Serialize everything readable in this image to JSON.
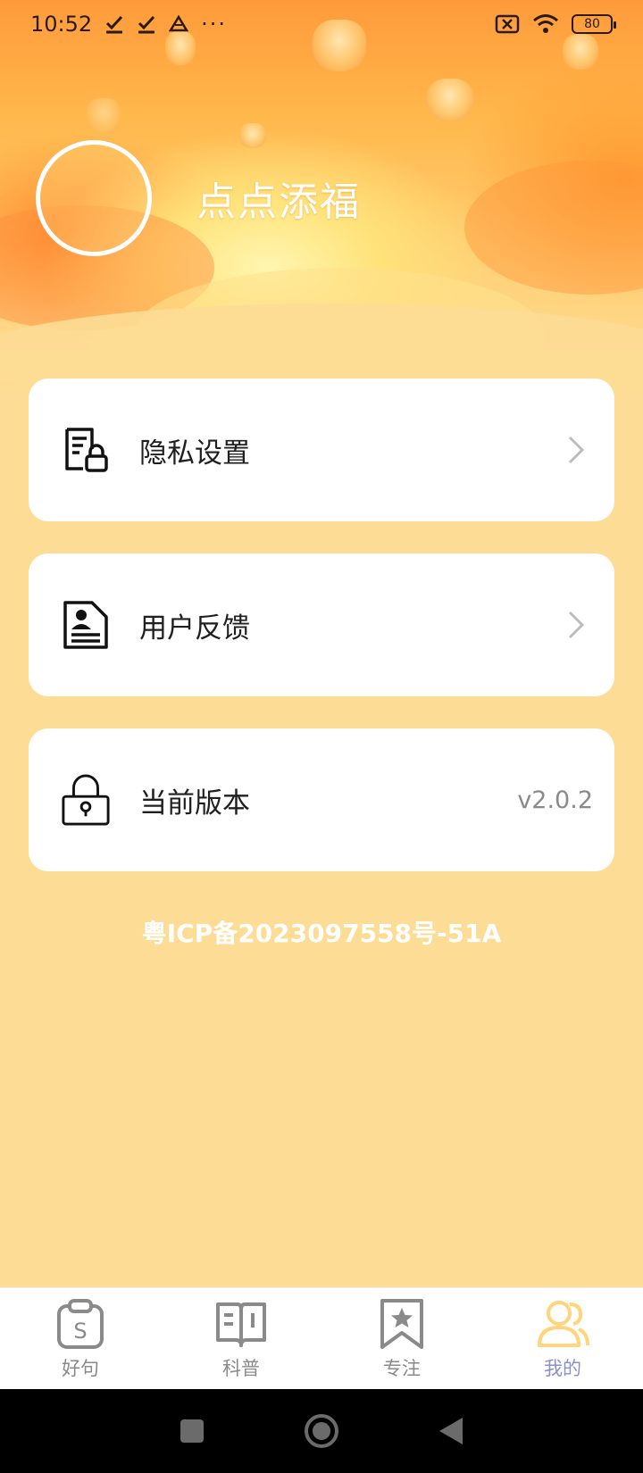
{
  "status_bar": {
    "time": "10:52",
    "battery": "80",
    "left_icons": [
      "download-done-icon",
      "download-done-icon",
      "drive-icon",
      "more-dots-icon"
    ],
    "right_icons": [
      "no-sim-icon",
      "wifi-icon",
      "battery-icon"
    ]
  },
  "profile": {
    "app_name": "点点添福"
  },
  "menu": {
    "items": [
      {
        "label": "隐私设置",
        "icon": "privacy-document-lock-icon"
      },
      {
        "label": "用户反馈",
        "icon": "feedback-document-icon"
      },
      {
        "label": "当前版本",
        "icon": "padlock-icon",
        "value": "v2.0.2"
      }
    ]
  },
  "footer": {
    "icp": "粤ICP备2023097558号-51A"
  },
  "tabs": [
    {
      "label": "好句",
      "icon": "clipboard-s-icon",
      "active": false
    },
    {
      "label": "科普",
      "icon": "open-book-icon",
      "active": false
    },
    {
      "label": "专注",
      "icon": "bookmark-star-icon",
      "active": false
    },
    {
      "label": "我的",
      "icon": "users-icon",
      "active": true
    }
  ],
  "colors": {
    "background": "#fddc95",
    "card": "#ffffff",
    "active_tab": "#8a8fd0",
    "active_tab_icon": "#ffd47a",
    "inactive_tab": "#8a8a8a"
  }
}
